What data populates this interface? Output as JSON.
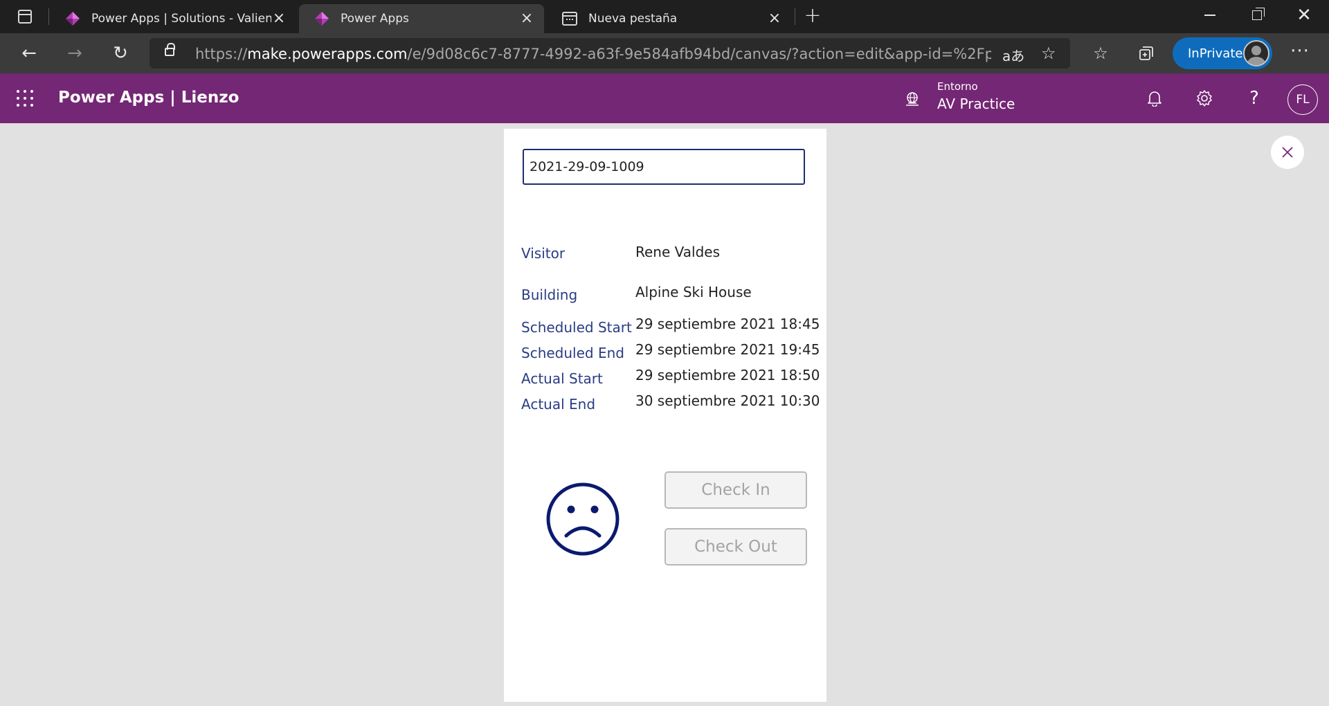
{
  "browser": {
    "tabs": [
      {
        "title": "Power Apps | Solutions - Valiente",
        "active": false
      },
      {
        "title": "Power Apps",
        "active": true
      },
      {
        "title": "Nueva pestaña",
        "active": false
      }
    ],
    "url_scheme": "https://",
    "url_host": "make.powerapps.com",
    "url_path": "/e/9d08c6c7-8777-4992-a63f-9e584afb94bd/canvas/?action=edit&app-id=%2Fproviders%2...",
    "read_aloud_glyph": "aあ",
    "inprivate_label": "InPrivate"
  },
  "header": {
    "brand": "Power Apps  |  Lienzo",
    "env_label": "Entorno",
    "env_name": "AV Practice",
    "avatar_initials": "FL",
    "help_glyph": "?",
    "brand_color": "#742774"
  },
  "canvas": {
    "booking_id": "2021-29-09-1009",
    "fields": [
      {
        "label": "Visitor",
        "value": "Rene Valdes"
      },
      {
        "label": "Building",
        "value": "Alpine Ski House"
      },
      {
        "label": "Scheduled Start",
        "value": "29 septiembre 2021 18:45"
      },
      {
        "label": "Scheduled End",
        "value": "29 septiembre 2021 19:45"
      },
      {
        "label": "Actual Start",
        "value": "29 septiembre 2021 18:50"
      },
      {
        "label": "Actual End",
        "value": "30 septiembre 2021 10:30"
      }
    ],
    "status_icon": "sad-face-icon",
    "check_in_label": "Check In",
    "check_out_label": "Check Out"
  }
}
